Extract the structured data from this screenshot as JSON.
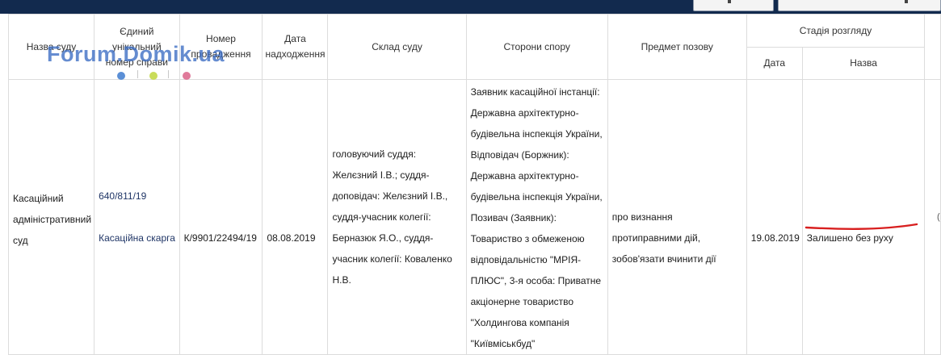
{
  "table": {
    "headers": {
      "court_name": "Назва суду",
      "case_number": "Єдиний унікальний номер справи",
      "proceeding_number": "Номер провадження",
      "received_date": "Дата надходження",
      "court_composition": "Склад суду",
      "parties": "Сторони спору",
      "claim_subject": "Предмет позову",
      "stage_group": "Стадія розгляду",
      "stage_date": "Дата",
      "stage_name": "Назва"
    },
    "rows": [
      {
        "court_name": "Касаційний адміністративний суд",
        "case_number": "640/811/19",
        "case_type": "Касаційна скарга",
        "proceeding_number": "К/9901/22494/19",
        "received_date": "08.08.2019",
        "court_composition": "головуючий суддя: Желєзний І.В.; суддя-доповідач: Желєзний І.В., суддя-учасник колегії: Берназюк Я.О., суддя-учасник колегії: Коваленко Н.В.",
        "parties": "Заявник касаційної інстанції: Державна архітектурно-будівельна інспекція України, Відповідач (Боржник): Державна архітектурно-будівельна інспекція України, Позивач (Заявник): Товариство з обмеженою відповідальністю \"МРІЯ-ПЛЮС\", 3-я особа: Приватне акціонерне товариство \"Холдингова компанія \"Київміськбуд\"",
        "claim_subject": "про визнання протиправними дій, зобов'язати вчинити дії",
        "stage_date": "19.08.2019",
        "stage_name": "Залишено без руху"
      }
    ]
  },
  "watermark": {
    "text": "Forum.Domik.ua",
    "dot_colors": [
      "#5b8fd6",
      "#c9dc5a",
      "#e07a9a"
    ]
  },
  "colors": {
    "topbar": "#122a4e",
    "annotation_underline": "#d81f1f"
  }
}
